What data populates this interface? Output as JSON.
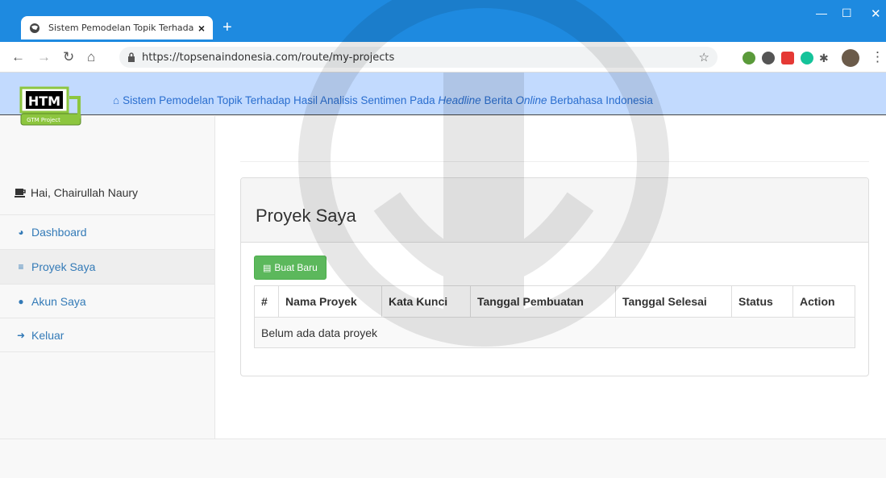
{
  "browser": {
    "tab_title": "Sistem Pemodelan Topik Terhada",
    "tab_close": "×",
    "new_tab": "+",
    "url": "https://topsenaindonesia.com/route/my-projects",
    "controls": {
      "minimize": "—",
      "maximize": "☐",
      "close": "✕"
    }
  },
  "header": {
    "logo_text": "HTM",
    "logo_subtext": "GTM Project",
    "title_parts": [
      "Sistem Pemodelan Topik Terhadap Hasil Analisis Sentimen Pada ",
      "Headline",
      " Berita ",
      "Online",
      " Berbahasa Indonesia"
    ]
  },
  "sidebar": {
    "greeting": "Hai, Chairullah Naury",
    "items": [
      {
        "label": "Dashboard",
        "icon": "dashboard-icon",
        "active": false
      },
      {
        "label": "Proyek Saya",
        "icon": "database-icon",
        "active": true
      },
      {
        "label": "Akun Saya",
        "icon": "user-icon",
        "active": false
      },
      {
        "label": "Keluar",
        "icon": "logout-icon",
        "active": false
      }
    ]
  },
  "main": {
    "panel_title": "Proyek Saya",
    "new_button": "Buat Baru",
    "table": {
      "columns": [
        "#",
        "Nama Proyek",
        "Kata Kunci",
        "Tanggal Pembuatan",
        "Tanggal Selesai",
        "Status",
        "Action"
      ],
      "empty_message": "Belum ada data proyek"
    }
  },
  "colors": {
    "browser_bar": "#1e8ae0",
    "header_bg": "#c2dafe",
    "link": "#337ab7",
    "success": "#5cb85c"
  }
}
